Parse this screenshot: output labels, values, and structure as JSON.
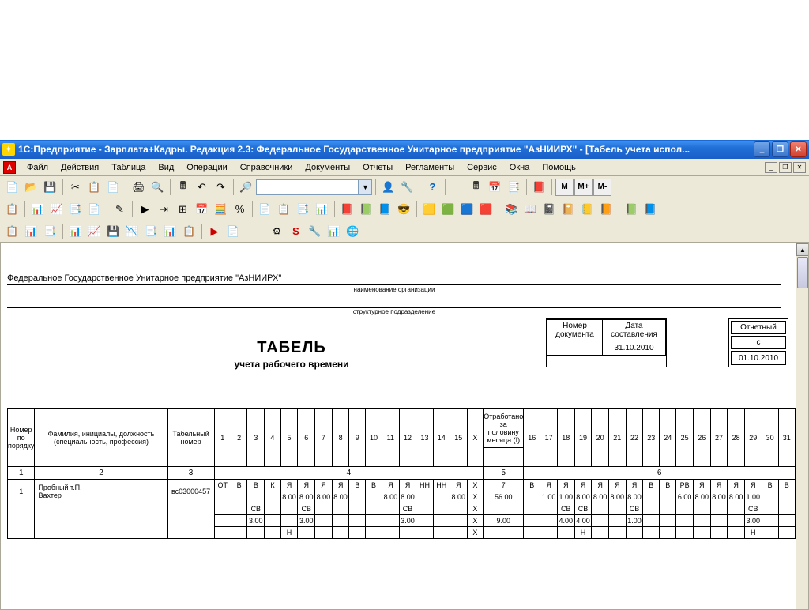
{
  "window": {
    "title": "1С:Предприятие - Зарплата+Кадры. Редакция 2.3: Федеральное Государственное Унитарное предприятие \"АзНИИРХ\" - [Табель учета испол..."
  },
  "menu": {
    "items": [
      "Файл",
      "Действия",
      "Таблица",
      "Вид",
      "Операции",
      "Справочники",
      "Документы",
      "Отчеты",
      "Регламенты",
      "Сервис",
      "Окна",
      "Помощь"
    ]
  },
  "doc": {
    "org_name": "Федеральное Государственное Унитарное предприятие \"АзНИИРХ\"",
    "org_caption": "наименование организации",
    "dept_caption": "структурное подразделение",
    "title": "ТАБЕЛЬ",
    "subtitle": "учета  рабочего времени",
    "hdr_docnum": "Номер документа",
    "hdr_date": "Дата составления",
    "date_value": "31.10.2010",
    "hdr_report": "Отчетный",
    "hdr_from": "с",
    "report_from_value": "01.10.2010"
  },
  "headers": {
    "num": "Номер по порядку",
    "fio": "Фамилия, инициалы, должность (специальность, профессия)",
    "tabnum": "Табельный номер",
    "half": "Отработано за половину месяца (I)",
    "col_nums": [
      "1",
      "2",
      "3",
      "4",
      "5",
      "6"
    ]
  },
  "days": [
    "1",
    "2",
    "3",
    "4",
    "5",
    "6",
    "7",
    "8",
    "9",
    "10",
    "11",
    "12",
    "13",
    "14",
    "15",
    "X"
  ],
  "days2": [
    "16",
    "17",
    "18",
    "19",
    "20",
    "21",
    "22",
    "23",
    "24",
    "25",
    "26",
    "27",
    "28",
    "29",
    "30",
    "31"
  ],
  "rows": [
    {
      "num": "1",
      "fio_line1": "Пробный т.П.",
      "fio_line2": "Вахтер",
      "tabnum": "вс03000457",
      "r1": [
        "ОТ",
        "В",
        "В",
        "К",
        "Я",
        "Я",
        "Я",
        "Я",
        "В",
        "В",
        "Я",
        "Я",
        "НН",
        "НН",
        "Я",
        "X",
        "7",
        "В",
        "Я",
        "Я",
        "Я",
        "Я",
        "Я",
        "Я",
        "В",
        "В",
        "РВ",
        "Я",
        "Я",
        "Я",
        "Я",
        "В",
        "В"
      ],
      "r2": [
        "",
        "",
        "",
        "",
        "8.00",
        "8.00",
        "8.00",
        "8.00",
        "",
        "",
        "8.00",
        "8.00",
        "",
        "",
        "8.00",
        "X",
        "56.00",
        "",
        "1.00",
        "1.00",
        "8.00",
        "8.00",
        "8.00",
        "8.00",
        "",
        "",
        "6.00",
        "8.00",
        "8.00",
        "8.00",
        "1.00",
        "",
        ""
      ],
      "r3": [
        "",
        "",
        "СВ",
        "",
        "",
        "СВ",
        "",
        "",
        "",
        "",
        "",
        "СВ",
        "",
        "",
        "",
        "X",
        "",
        "",
        "",
        "СВ",
        "СВ",
        "",
        "",
        "СВ",
        "",
        "",
        "",
        "",
        "",
        "",
        "СВ",
        "",
        ""
      ],
      "r4": [
        "",
        "",
        "3.00",
        "",
        "",
        "3.00",
        "",
        "",
        "",
        "",
        "",
        "3.00",
        "",
        "",
        "",
        "X",
        "9.00",
        "",
        "",
        "4.00",
        "4.00",
        "",
        "",
        "1.00",
        "",
        "",
        "",
        "",
        "",
        "",
        "3.00",
        "",
        ""
      ],
      "r5": [
        "",
        "",
        "",
        "",
        "Н",
        "",
        "",
        "",
        "",
        "",
        "",
        "",
        "",
        "",
        "",
        "X",
        "",
        "",
        "",
        "",
        "Н",
        "",
        "",
        "",
        "",
        "",
        "",
        "",
        "",
        "",
        "Н",
        "",
        ""
      ]
    }
  ]
}
